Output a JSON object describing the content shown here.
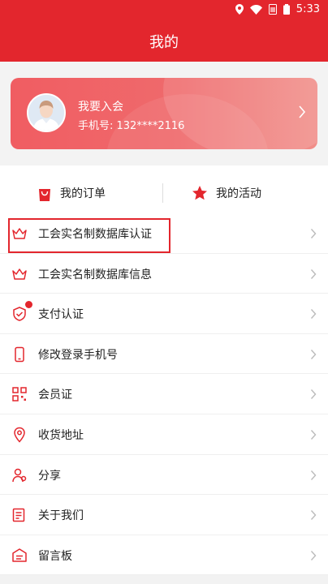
{
  "status_bar": {
    "time": "5:33"
  },
  "header": {
    "title": "我的"
  },
  "profile_card": {
    "join_text": "我要入会",
    "phone_label": "手机号: 132****2116"
  },
  "quick_actions": [
    {
      "label": "我的订单",
      "icon": "shopping-bag-icon"
    },
    {
      "label": "我的活动",
      "icon": "star-icon"
    }
  ],
  "menu": [
    {
      "label": "工会实名制数据库认证",
      "icon": "crown-icon"
    },
    {
      "label": "工会实名制数据库信息",
      "icon": "crown-icon"
    },
    {
      "label": "支付认证",
      "icon": "shield-check-icon",
      "badge_dot": true
    },
    {
      "label": "修改登录手机号",
      "icon": "phone-icon"
    },
    {
      "label": "会员证",
      "icon": "qr-code-icon"
    },
    {
      "label": "收货地址",
      "icon": "location-pin-icon"
    },
    {
      "label": "分享",
      "icon": "user-share-icon"
    },
    {
      "label": "关于我们",
      "icon": "note-edit-icon"
    },
    {
      "label": "留言板",
      "icon": "message-board-icon"
    }
  ],
  "colors": {
    "brand_red": "#e3262d",
    "card_gradient_start": "#f05d62",
    "card_gradient_end": "#f18e89"
  }
}
